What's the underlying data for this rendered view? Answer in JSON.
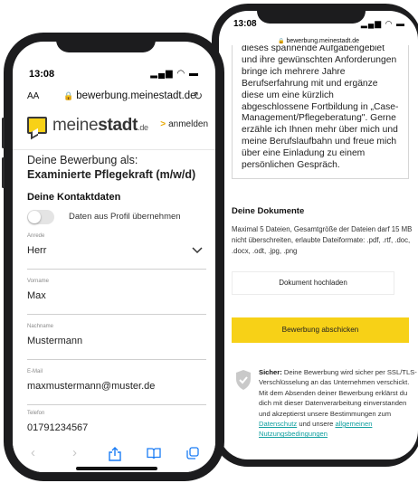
{
  "back_phone": {
    "status": {
      "time": "13:08",
      "icons": "▂▄▆ ◠ ▬"
    },
    "url": "bewerbung.meinestadt.de",
    "letter_text": "dieses spannende Aufgabengebiet und ihre gewünschten Anforderungen bringe ich mehrere Jahre Berufserfahrung mit und ergänze diese um eine kürzlich abgeschlossene Fortbildung in „Case-Management/Pflegeberatung\". Gerne erzähle ich Ihnen mehr über mich und meine Berufslaufbahn und freue mich über eine Einladung zu einem persönlichen Gespräch.",
    "documents": {
      "title": "Deine Dokumente",
      "description": "Maximal 5 Dateien, Gesamtgröße der Dateien darf 15 MB nicht überschreiten, erlaubte Dateiformate: .pdf, .rtf, .doc, .docx, .odt, .jpg, .png",
      "upload_label": "Dokument hochladen"
    },
    "submit_label": "Bewerbung abschicken",
    "secure": {
      "heading": "Sicher:",
      "text": "Deine Bewerbung wird sicher per SSL/TLS-Verschlüsselung an das Unternehmen verschickt. Mit dem Absenden deiner Bewerbung erklärst du dich mit dieser Datenverarbeitung einverstanden und akzeptierst unsere Bestimmungen zum",
      "privacy_link": "Datenschutz",
      "and_text": "und unsere",
      "terms_link": "allgemeinen Nutzungsbedingungen"
    }
  },
  "front_phone": {
    "status": {
      "time": "13:08",
      "icons": "▂▄▆ ◠ ▬"
    },
    "url_bar": {
      "aa": "AA",
      "url": "bewerbung.meinestadt.de",
      "reload_icon": "↻"
    },
    "header": {
      "logo_regular": "meine",
      "logo_bold": "stadt",
      "logo_suffix": ".de",
      "login_label": "anmelden",
      "login_chevron": ">"
    },
    "application_label": "Deine Bewerbung als:",
    "application_job": "Examinierte Pflegekraft (m/w/d)",
    "contact_title": "Deine Kontaktdaten",
    "profile_toggle_label": "Daten aus Profil übernehmen",
    "profile_toggle_on": false,
    "fields": [
      {
        "label": "Anrede",
        "value": "Herr"
      },
      {
        "label": "Vorname",
        "value": "Max"
      },
      {
        "label": "Nachname",
        "value": "Mustermann"
      },
      {
        "label": "E-Mail",
        "value": "maxmustermann@muster.de"
      },
      {
        "label": "Telefon",
        "value": "01791234567"
      }
    ],
    "toolbar": {
      "back": "‹",
      "forward": "›",
      "share": "↑",
      "bookmarks": "☷",
      "tabs": "⧉"
    }
  },
  "colors": {
    "brand_yellow": "#f7d117",
    "link_teal": "#12a0a0",
    "ios_blue": "#1a7cf5"
  }
}
